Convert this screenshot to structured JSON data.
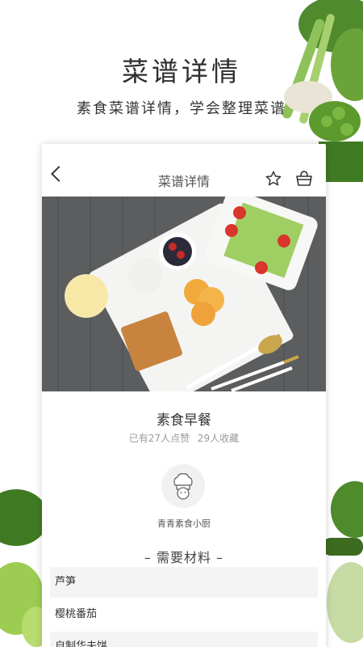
{
  "promo": {
    "title": "菜谱详情",
    "subtitle": "素食菜谱详情，学会整理菜谱"
  },
  "nav": {
    "title": "菜谱详情"
  },
  "recipe": {
    "name": "素食早餐",
    "likes": "已有27人点赞",
    "favorites": "29人收藏",
    "author": "青青素食小厨"
  },
  "ingredients_section": {
    "title": "– 需要材料 –",
    "items": [
      "芦笋",
      "樱桃番茄",
      "自制华夫饼"
    ]
  },
  "icons": {
    "back": "chevron-left-icon",
    "favorite": "star-icon",
    "cart": "basket-icon",
    "avatar": "chef-hat-icon"
  },
  "colors": {
    "text_dark": "#333333",
    "text_muted": "#999999",
    "row_bg": "#f4f4f4",
    "photo_bg": "#5b5d5f"
  }
}
